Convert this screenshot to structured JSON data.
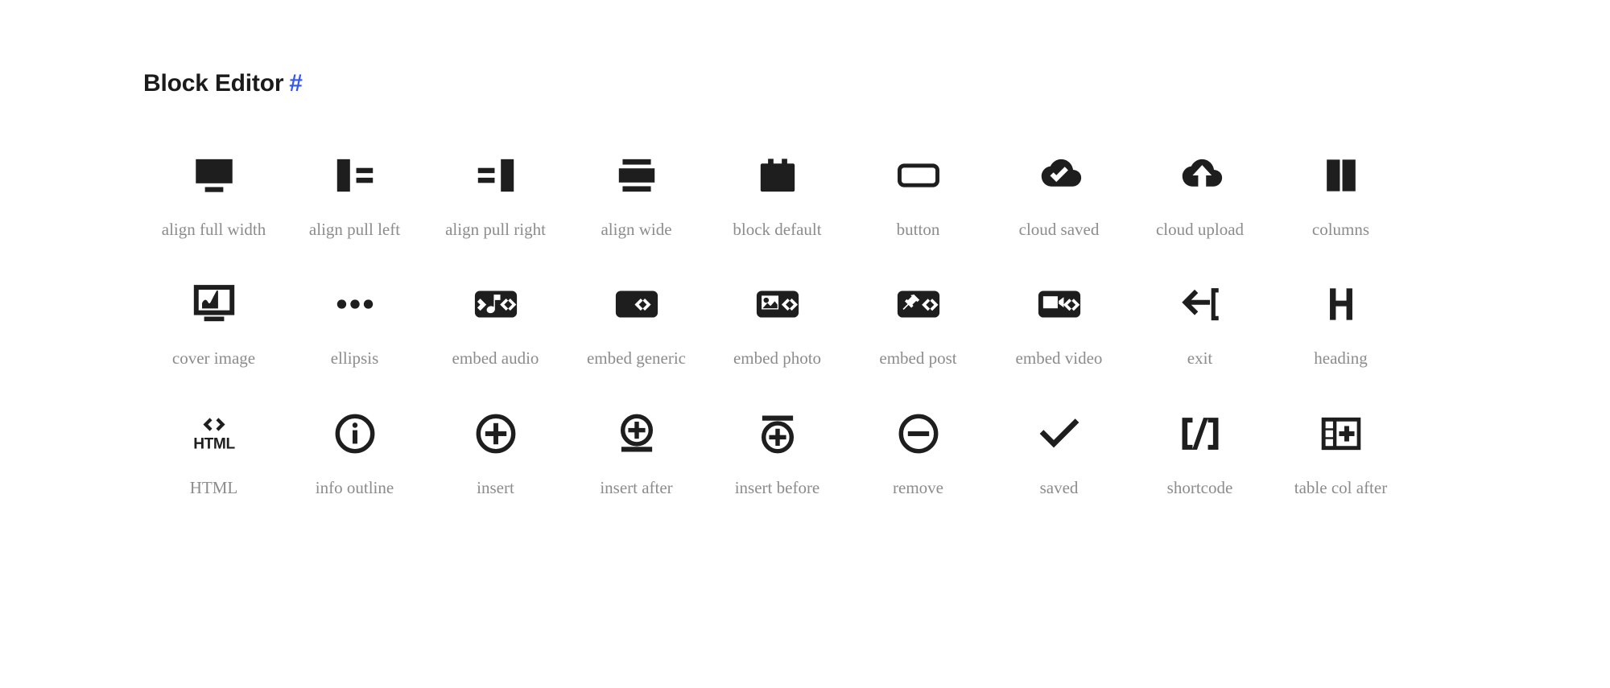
{
  "page": {
    "background_color": "#ffffff",
    "title": "Block Editor",
    "anchor_symbol": "#",
    "anchor_color": "#3858e9",
    "title_color": "#1b1b1b",
    "icon_color": "#1e1e1e",
    "label_color": "#8c8c8c"
  },
  "icons": [
    {
      "name": "align-full-width",
      "label": "align full width"
    },
    {
      "name": "align-pull-left",
      "label": "align pull left"
    },
    {
      "name": "align-pull-right",
      "label": "align pull right"
    },
    {
      "name": "align-wide",
      "label": "align wide"
    },
    {
      "name": "block-default",
      "label": "block default"
    },
    {
      "name": "button",
      "label": "button"
    },
    {
      "name": "cloud-saved",
      "label": "cloud saved"
    },
    {
      "name": "cloud-upload",
      "label": "cloud upload"
    },
    {
      "name": "columns",
      "label": "columns"
    },
    {
      "name": "cover-image",
      "label": "cover image"
    },
    {
      "name": "ellipsis",
      "label": "ellipsis"
    },
    {
      "name": "embed-audio",
      "label": "embed audio"
    },
    {
      "name": "embed-generic",
      "label": "embed generic"
    },
    {
      "name": "embed-photo",
      "label": "embed photo"
    },
    {
      "name": "embed-post",
      "label": "embed post"
    },
    {
      "name": "embed-video",
      "label": "embed video"
    },
    {
      "name": "exit",
      "label": "exit"
    },
    {
      "name": "heading",
      "label": "heading"
    },
    {
      "name": "html",
      "label": "HTML"
    },
    {
      "name": "info-outline",
      "label": "info outline"
    },
    {
      "name": "insert",
      "label": "insert"
    },
    {
      "name": "insert-after",
      "label": "insert after"
    },
    {
      "name": "insert-before",
      "label": "insert before"
    },
    {
      "name": "remove",
      "label": "remove"
    },
    {
      "name": "saved",
      "label": "saved"
    },
    {
      "name": "shortcode",
      "label": "shortcode"
    },
    {
      "name": "table-col-after",
      "label": "table col after"
    }
  ]
}
